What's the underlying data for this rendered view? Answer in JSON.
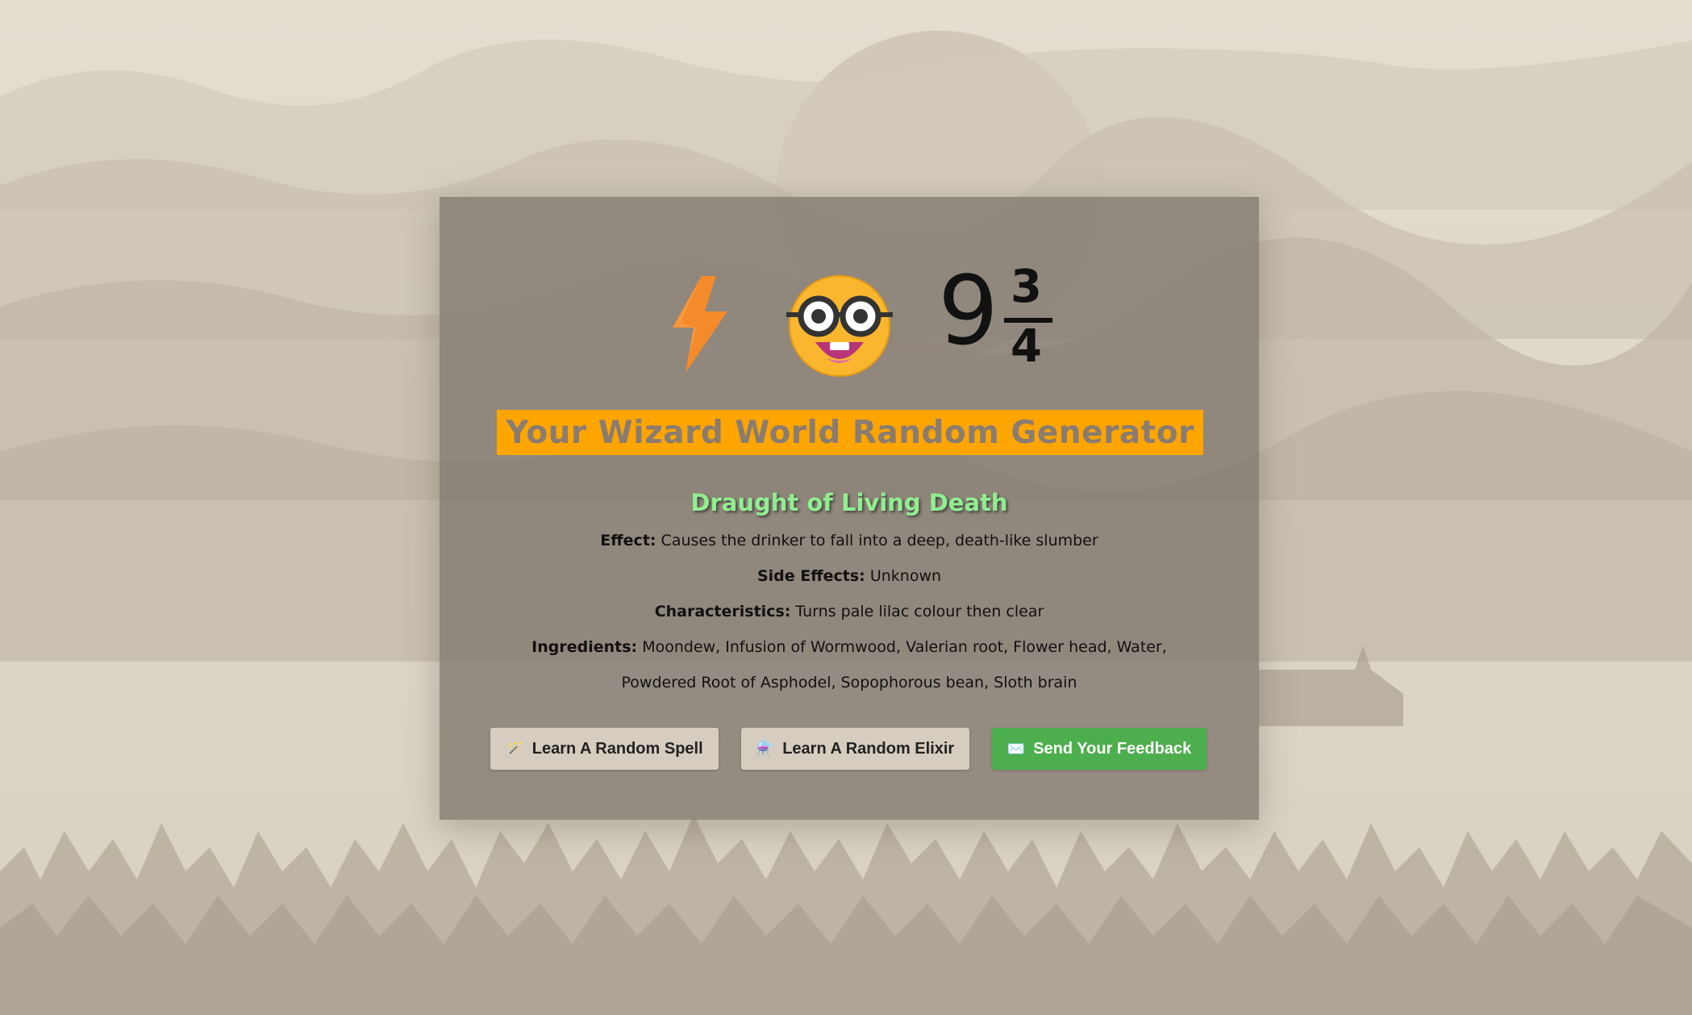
{
  "colors": {
    "title_bar": "#ffa500",
    "title_text": "#8a7c70",
    "potion_name": "#90ee90",
    "card_bg": "rgba(128,119,110,0.78)",
    "feedback_button": "#4cae4c",
    "neutral_button": "#d6cdc0"
  },
  "header": {
    "icons": [
      "lightning-bolt-icon",
      "nerd-face-icon",
      "platform-nine-three-quarters-icon"
    ],
    "platform_whole": "9",
    "platform_numerator": "3",
    "platform_denominator": "4",
    "title": "Your Wizard World Random Generator"
  },
  "elixir": {
    "name": "Draught of Living Death",
    "effect_label": "Effect:",
    "effect": "Causes the drinker to fall into a deep, death-like slumber",
    "side_effects_label": "Side Effects:",
    "side_effects": "Unknown",
    "characteristics_label": "Characteristics:",
    "characteristics": "Turns pale lilac colour then clear",
    "ingredients_label": "Ingredients:",
    "ingredients": "Moondew, Infusion of Wormwood, Valerian root, Flower head, Water, Powdered Root of Asphodel, Sopophorous bean, Sloth brain"
  },
  "buttons": {
    "spell": {
      "icon": "magic-wand-icon",
      "glyph": "🪄",
      "label": "Learn A Random Spell"
    },
    "elixir": {
      "icon": "alembic-icon",
      "glyph": "⚗️",
      "label": "Learn A Random Elixir"
    },
    "feedback": {
      "icon": "envelope-icon",
      "glyph": "✉️",
      "label": "Send Your Feedback"
    }
  }
}
